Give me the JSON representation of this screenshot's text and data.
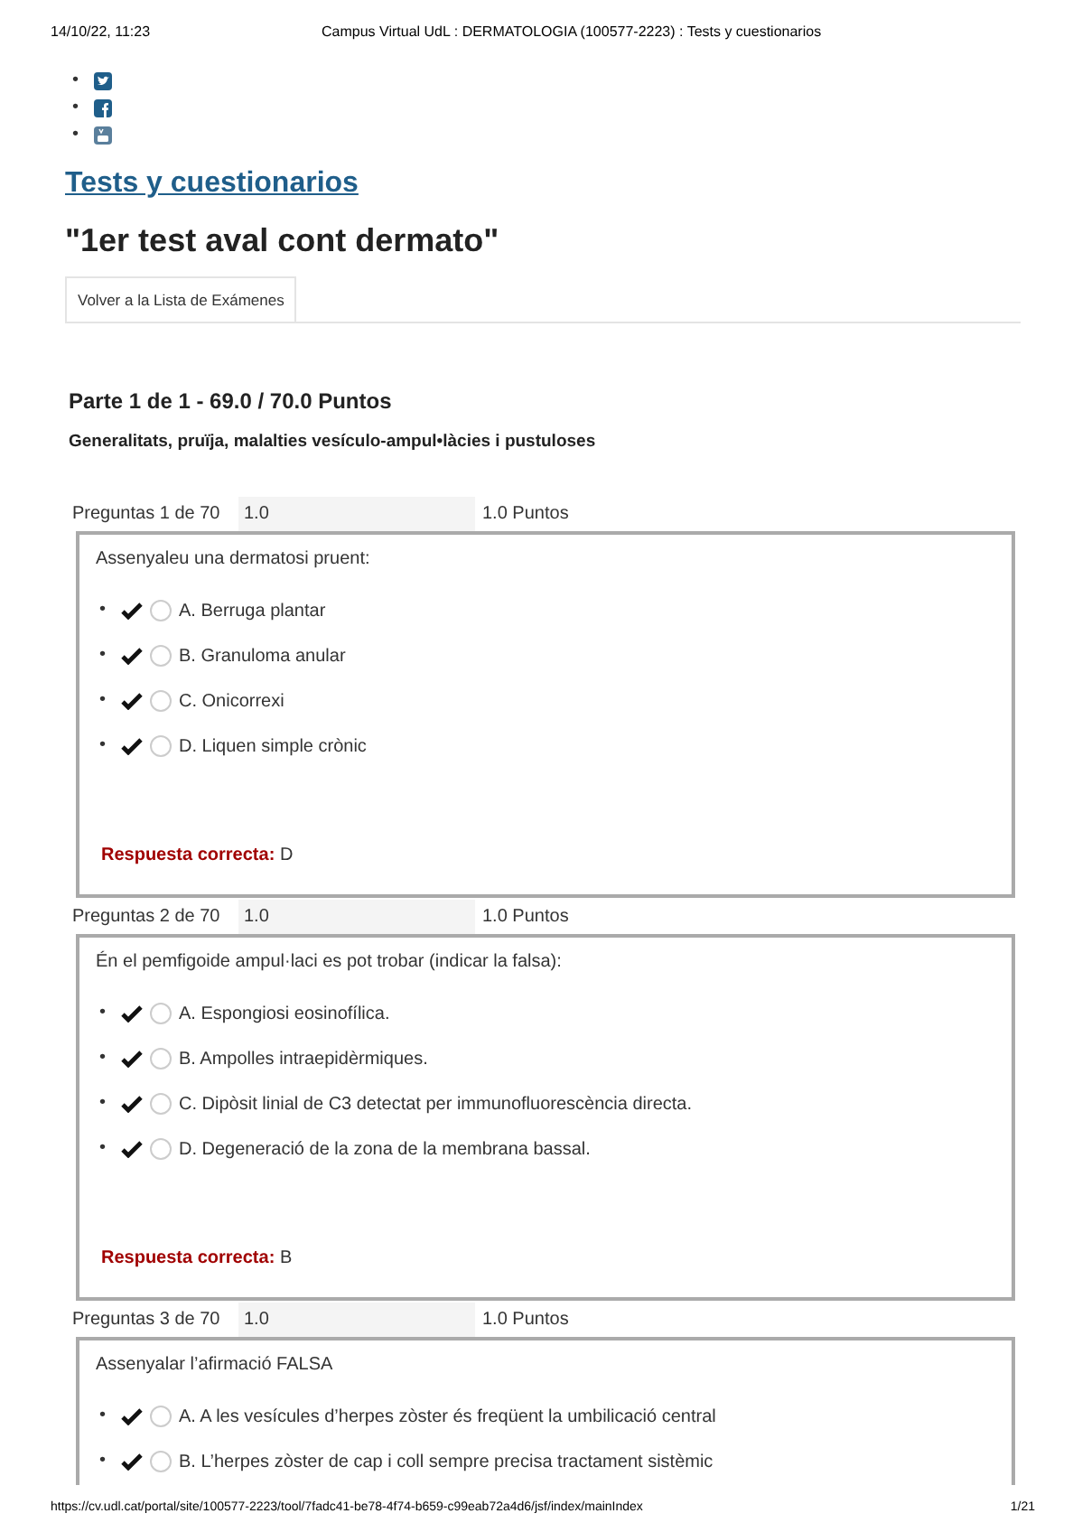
{
  "print_header": {
    "date": "14/10/22, 11:23",
    "title": "Campus Virtual UdL : DERMATOLOGIA (100577-2223) : Tests y cuestionarios"
  },
  "social_links": [
    {
      "marker": "•",
      "kind": "twitter"
    },
    {
      "marker": "•",
      "kind": "facebook"
    },
    {
      "marker": "•",
      "kind": "youtube"
    }
  ],
  "breadcrumb": "Tests y cuestionarios",
  "heading": "\"1er test aval cont dermato\"",
  "tabs": [
    {
      "label": "Volver a la Lista de Exámenes",
      "selected": true
    }
  ],
  "part": {
    "title": "Parte 1 de 1 - 69.0 / 70.0 Puntos",
    "subtitle": "Generalitats, pruïja, malalties vesículo-ampul•làcies i pustuloses"
  },
  "questions": [
    {
      "label": "Preguntas 1 de 70",
      "score": "1.0",
      "points": "1.0 Puntos",
      "text": "Assenyaleu una dermatosi pruent:",
      "options": [
        {
          "marker": "•",
          "text": "A. Berruga plantar",
          "selected": false
        },
        {
          "marker": "•",
          "text": "B. Granuloma anular",
          "selected": false
        },
        {
          "marker": "•",
          "text": "C. Onicorrexi",
          "selected": false
        },
        {
          "marker": "•",
          "text": "D. Liquen simple crònic",
          "selected": false
        }
      ],
      "answer_label": "Respuesta correcta:",
      "answer": "D"
    },
    {
      "label": "Preguntas 2 de 70",
      "score": "1.0",
      "points": "1.0 Puntos",
      "text": "Én el pemfigoide ampul·laci es pot trobar (indicar la falsa):",
      "options": [
        {
          "marker": "•",
          "text": "A. Espongiosi eosinofílica.",
          "selected": false
        },
        {
          "marker": "•",
          "text": "B. Ampolles intraepidèrmiques.",
          "selected": false
        },
        {
          "marker": "•",
          "text": "C. Dipòsit linial de C3 detectat per immunofluorescència directa.",
          "selected": false
        },
        {
          "marker": "•",
          "text": "D. Degeneració de la zona de la membrana bassal.",
          "selected": false
        }
      ],
      "answer_label": "Respuesta correcta:",
      "answer": "B"
    },
    {
      "label": "Preguntas 3 de 70",
      "score": "1.0",
      "points": "1.0 Puntos",
      "text": "Assenyalar l’afirmació FALSA",
      "options": [
        {
          "marker": "•",
          "text": "A. A les vesícules d’herpes zòster és freqüent la umbilicació central",
          "selected": false
        },
        {
          "marker": "•",
          "text": "B. L’herpes zòster de cap i coll sempre precisa tractament sistèmic",
          "selected": false
        }
      ]
    }
  ],
  "print_footer": {
    "url": "https://cv.udl.cat/portal/site/100577-2223/tool/7fadc41-be78-4f74-b659-c99eab72a4d6/jsf/index/mainIndex",
    "page": "1/21"
  }
}
